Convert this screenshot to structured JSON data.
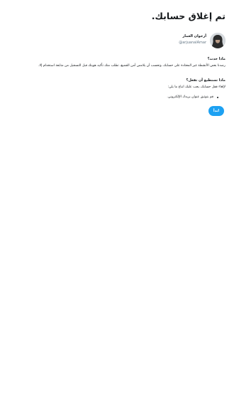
{
  "page": {
    "title": "تم إغلاق حسابك."
  },
  "account": {
    "display_name": "أرجوان العمار",
    "handle": "@arjuanalAmar",
    "avatar_icon": "user-avatar-icon"
  },
  "what_happened": {
    "heading": "ماذا حدث؟",
    "body": "رصدنا بعض الأنشطة غير المعتادة على حسابك، وتحسب أن يلامس أمن الجميع، تطلب منك تأكيد هويتك قبل التسجيل من متابعة استخدام إلا."
  },
  "what_to_do": {
    "heading": "ماذا تستطيع أن تفعل؟",
    "body": "لإلغاء قفل حسابك، يجب عليك اتباع ما يلي:",
    "steps": [
      "قم بتوثيق عنوان بريدك الإلكتروني."
    ]
  },
  "actions": {
    "start_label": "ابدأ"
  },
  "colors": {
    "accent": "#1da1f2",
    "text": "#14171a",
    "muted": "#657786"
  }
}
